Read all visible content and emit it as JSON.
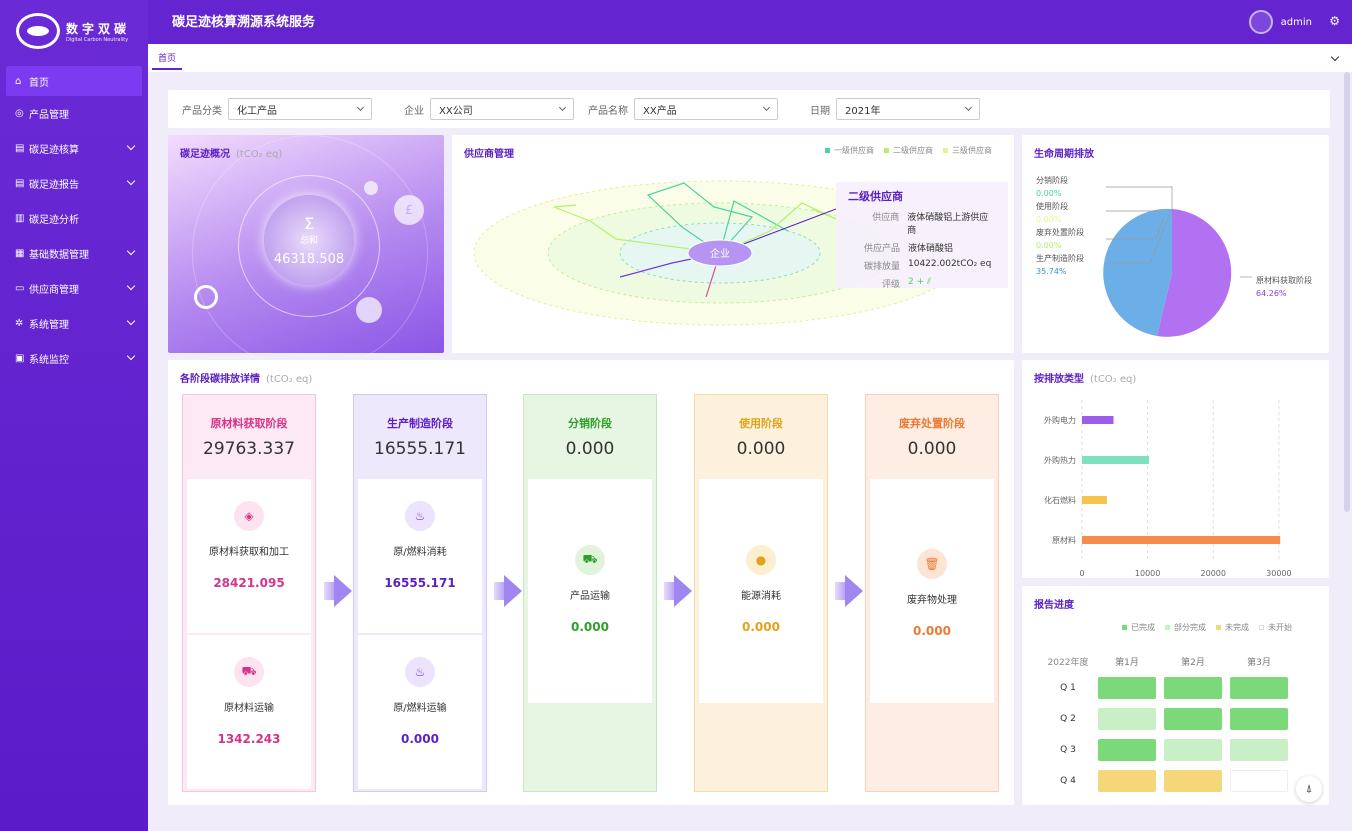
{
  "brand": {
    "title": "数字双碳",
    "subtitle": "Digital Carbon Neutrality"
  },
  "header": {
    "title": "碳足迹核算溯源系统服务",
    "user": "admin"
  },
  "tab": {
    "label": "首页"
  },
  "sidebar": {
    "items": [
      {
        "label": "首页"
      },
      {
        "label": "产品管理"
      },
      {
        "label": "碳足迹核算"
      },
      {
        "label": "碳足迹报告"
      },
      {
        "label": "碳足迹分析"
      },
      {
        "label": "基础数据管理"
      },
      {
        "label": "供应商管理"
      },
      {
        "label": "系统管理"
      },
      {
        "label": "系统监控"
      }
    ]
  },
  "filters": [
    {
      "label": "产品分类",
      "value": "化工产品"
    },
    {
      "label": "企业",
      "value": "XX公司"
    },
    {
      "label": "产品名称",
      "value": "XX产品"
    },
    {
      "label": "日期",
      "value": "2021年"
    }
  ],
  "overview": {
    "title": "碳足迹概况",
    "unit": "(tCO₂ eq)",
    "sum_label": "总和",
    "total": "46318.508",
    "pound": "£"
  },
  "supplier": {
    "title": "供应商管理",
    "legend": [
      "一级供应商",
      "二级供应商",
      "三级供应商"
    ],
    "center": "企业",
    "info": {
      "heading": "二级供应商",
      "rows": [
        {
          "k": "供应商",
          "v": "液体硝酸铝上游供应商"
        },
        {
          "k": "供应产品",
          "v": "液体硝酸铝"
        },
        {
          "k": "碳排放量",
          "v": "10422.002tCO₂ eq"
        },
        {
          "k": "评级",
          "v": "2 + ⫽"
        }
      ]
    }
  },
  "lifecycle": {
    "title": "生命周期排放",
    "labels": [
      {
        "name": "分销阶段",
        "pct": "0.00%"
      },
      {
        "name": "使用阶段",
        "pct": "0.00%"
      },
      {
        "name": "废弃处置阶段",
        "pct": "0.00%"
      },
      {
        "name": "生产制造阶段",
        "pct": "35.74%"
      },
      {
        "name": "原材料获取阶段",
        "pct": "64.26%"
      }
    ]
  },
  "stages": {
    "title": "各阶段碳排放详情",
    "unit": "(tCO₂ eq)",
    "list": [
      {
        "name": "原材料获取阶段",
        "total": "29763.337",
        "items": [
          {
            "name": "原材料获取和加工",
            "value": "28421.095"
          },
          {
            "name": "原材料运输",
            "value": "1342.243"
          }
        ]
      },
      {
        "name": "生产制造阶段",
        "total": "16555.171",
        "items": [
          {
            "name": "原/燃料消耗",
            "value": "16555.171"
          },
          {
            "name": "原/燃料运输",
            "value": "0.000"
          }
        ]
      },
      {
        "name": "分销阶段",
        "total": "0.000",
        "items": [
          {
            "name": "产品运输",
            "value": "0.000"
          }
        ]
      },
      {
        "name": "使用阶段",
        "total": "0.000",
        "items": [
          {
            "name": "能源消耗",
            "value": "0.000"
          }
        ]
      },
      {
        "name": "废弃处置阶段",
        "total": "0.000",
        "items": [
          {
            "name": "废弃物处理",
            "value": "0.000"
          }
        ]
      }
    ]
  },
  "emtype": {
    "title": "按排放类型",
    "unit": "(tCO₂ eq)"
  },
  "chart_data": {
    "type": "bar",
    "orientation": "horizontal",
    "categories": [
      "外购电力",
      "外购热力",
      "化石燃料",
      "原材料"
    ],
    "values": [
      4800,
      10200,
      3800,
      30200
    ],
    "colors": [
      "#9c5de8",
      "#7fe0bf",
      "#f6c34f",
      "#f58b4d"
    ],
    "xticks": [
      "0",
      "10000",
      "20000",
      "30000"
    ],
    "xlim": [
      0,
      32000
    ],
    "grid": true
  },
  "report": {
    "title": "报告进度",
    "legend": [
      {
        "label": "已完成",
        "color": "#7cd97a"
      },
      {
        "label": "部分完成",
        "color": "#c9efc6"
      },
      {
        "label": "未完成",
        "color": "#f6d67a"
      },
      {
        "label": "未开始",
        "color": "#ffffff"
      }
    ],
    "year": "2022年度",
    "months": [
      "第1月",
      "第2月",
      "第3月"
    ],
    "quarters": [
      {
        "q": "Q 1",
        "s": [
          "#7cd97a",
          "#7cd97a",
          "#7cd97a"
        ]
      },
      {
        "q": "Q 2",
        "s": [
          "#c9efc6",
          "#7cd97a",
          "#7cd97a"
        ]
      },
      {
        "q": "Q 3",
        "s": [
          "#7cd97a",
          "#c9efc6",
          "#c9efc6"
        ]
      },
      {
        "q": "Q 4",
        "s": [
          "#f6d67a",
          "#f6d67a",
          "#ffffff"
        ]
      }
    ]
  }
}
